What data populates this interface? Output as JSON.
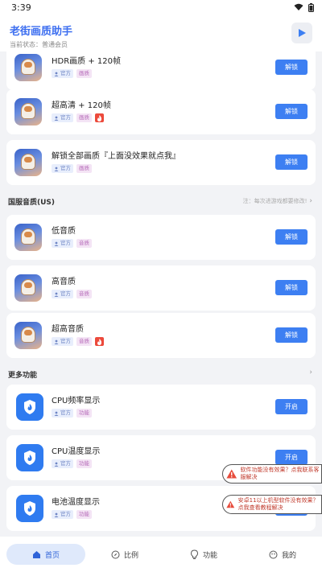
{
  "status_bar": {
    "time": "3:39"
  },
  "header": {
    "title": "老街画质助手",
    "subtitle": "当前状态：普通会员"
  },
  "tags": {
    "official": "官方",
    "quality": "画质",
    "audio": "音质",
    "feature": "功能"
  },
  "top_cards": [
    {
      "name": "HDR画质 + 120帧",
      "tag": "画质",
      "hot": false,
      "button": "解锁"
    },
    {
      "name": "超高清 + 120帧",
      "tag": "画质",
      "hot": true,
      "button": "解锁"
    },
    {
      "name": "解锁全部画质『上面没效果就点我』",
      "tag": "画质",
      "hot": false,
      "button": "解锁"
    }
  ],
  "sections": {
    "intl_audio": {
      "title": "国服音质(US)",
      "note": "注：每次进游戏都要修改!"
    },
    "more": {
      "title": "更多功能"
    }
  },
  "audio_cards": [
    {
      "name": "低音质",
      "tag": "音质",
      "hot": false,
      "button": "解锁"
    },
    {
      "name": "高音质",
      "tag": "音质",
      "hot": false,
      "button": "解锁"
    },
    {
      "name": "超高音质",
      "tag": "音质",
      "hot": true,
      "button": "解锁"
    }
  ],
  "feature_cards": [
    {
      "name": "CPU频率显示",
      "tag": "功能",
      "button": "开启"
    },
    {
      "name": "CPU温度显示",
      "tag": "功能",
      "button": "开启"
    },
    {
      "name": "电池温度显示",
      "tag": "功能",
      "button": "开启"
    }
  ],
  "toasts": [
    {
      "text": "软件功能没有效果？点我联系客服解决"
    },
    {
      "text": "安卓11以上机型软件没有效果？点我查看教程解决"
    }
  ],
  "tabbar": [
    {
      "label": "首页",
      "icon": "home-icon",
      "active": true
    },
    {
      "label": "比例",
      "icon": "compass-icon",
      "active": false
    },
    {
      "label": "功能",
      "icon": "bulb-icon",
      "active": false
    },
    {
      "label": "我的",
      "icon": "face-icon",
      "active": false
    }
  ],
  "colors": {
    "accent": "#3d7ff2",
    "title": "#3c6ef0",
    "hot": "#ec4a3c",
    "warning": "#e74c3c"
  }
}
